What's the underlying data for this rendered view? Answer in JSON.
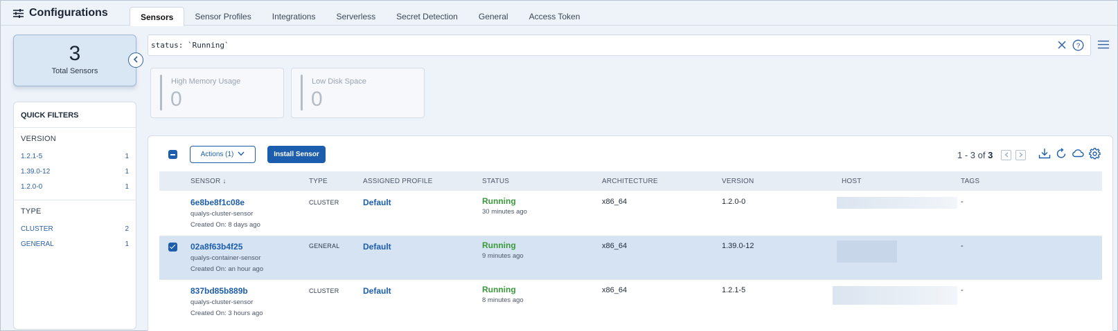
{
  "header": {
    "title": "Configurations",
    "tabs": [
      {
        "label": "Sensors",
        "active": true
      },
      {
        "label": "Sensor Profiles"
      },
      {
        "label": "Integrations"
      },
      {
        "label": "Serverless"
      },
      {
        "label": "Secret Detection"
      },
      {
        "label": "General"
      },
      {
        "label": "Access Token"
      }
    ]
  },
  "summary": {
    "count": "3",
    "label": "Total Sensors"
  },
  "quick_filters": {
    "title": "QUICK FILTERS",
    "sections": [
      {
        "heading": "VERSION",
        "items": [
          {
            "label": "1.2.1-5",
            "count": "1"
          },
          {
            "label": "1.39.0-12",
            "count": "1"
          },
          {
            "label": "1.2.0-0",
            "count": "1"
          }
        ]
      },
      {
        "heading": "TYPE",
        "items": [
          {
            "label": "CLUSTER",
            "count": "2"
          },
          {
            "label": "GENERAL",
            "count": "1"
          }
        ]
      }
    ]
  },
  "search": {
    "query": "status: `Running`"
  },
  "widgets": [
    {
      "label": "High Memory Usage",
      "value": "0"
    },
    {
      "label": "Low Disk Space",
      "value": "0"
    }
  ],
  "toolbar": {
    "actions_label": "Actions (1)",
    "install_label": "Install Sensor",
    "pager_range": "1 - 3 of",
    "pager_total": "3"
  },
  "table": {
    "columns": [
      "SENSOR",
      "TYPE",
      "ASSIGNED PROFILE",
      "STATUS",
      "ARCHITECTURE",
      "VERSION",
      "HOST",
      "TAGS"
    ],
    "rows": [
      {
        "id": "6e8be8f1c08e",
        "name": "qualys-cluster-sensor",
        "created": "Created On: 8 days ago",
        "type": "CLUSTER",
        "profile": "Default",
        "status": "Running",
        "status_time": "30 minutes ago",
        "arch": "x86_64",
        "version": "1.2.0-0",
        "tags": "-",
        "selected": false
      },
      {
        "id": "02a8f63b4f25",
        "name": "qualys-container-sensor",
        "created": "Created On: an hour ago",
        "type": "GENERAL",
        "profile": "Default",
        "status": "Running",
        "status_time": "9 minutes ago",
        "arch": "x86_64",
        "version": "1.39.0-12",
        "tags": "-",
        "selected": true
      },
      {
        "id": "837bd85b889b",
        "name": "qualys-cluster-sensor",
        "created": "Created On: 3 hours ago",
        "type": "CLUSTER",
        "profile": "Default",
        "status": "Running",
        "status_time": "8 minutes ago",
        "arch": "x86_64",
        "version": "1.2.1-5",
        "tags": "-",
        "selected": false
      }
    ]
  },
  "colors": {
    "accent": "#1d5dad",
    "running": "#3b9a3b",
    "selected_row": "#d5e3f2"
  }
}
